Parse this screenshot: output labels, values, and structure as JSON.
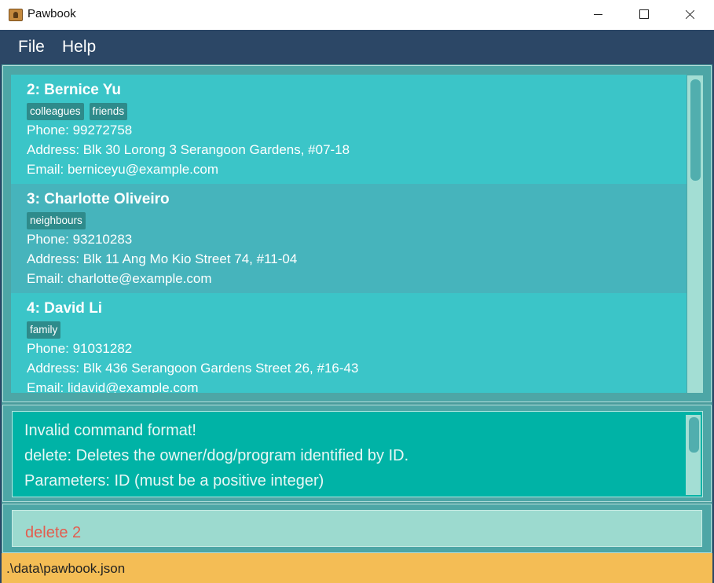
{
  "window": {
    "title": "Pawbook"
  },
  "menu": {
    "file": "File",
    "help": "Help"
  },
  "list": {
    "items": [
      {
        "name": "2:  Bernice Yu",
        "tags": [
          "colleagues",
          "friends"
        ],
        "phone": "Phone: 99272758",
        "address": "Address: Blk 30 Lorong 3 Serangoon Gardens, #07-18",
        "email": "Email: berniceyu@example.com"
      },
      {
        "name": "3:  Charlotte Oliveiro",
        "tags": [
          "neighbours"
        ],
        "phone": "Phone: 93210283",
        "address": "Address: Blk 11 Ang Mo Kio Street 74, #11-04",
        "email": "Email: charlotte@example.com"
      },
      {
        "name": "4:  David Li",
        "tags": [
          "family"
        ],
        "phone": "Phone: 91031282",
        "address": "Address: Blk 436 Serangoon Gardens Street 26, #16-43",
        "email": "Email: lidavid@example.com"
      }
    ]
  },
  "result": {
    "line1": "Invalid command format!",
    "line2": "delete: Deletes the owner/dog/program identified by ID.",
    "line3": "Parameters: ID (must be a positive integer)"
  },
  "command": {
    "value": "delete 2"
  },
  "status": {
    "path": ".\\data\\pawbook.json"
  },
  "colors": {
    "menubar": "#2c4766",
    "card_even": "#3bc5c8",
    "card_odd": "#46b4bc",
    "tag": "#2e8b8b",
    "result_bg": "#00b3a6",
    "command_bg": "#9cdacf",
    "command_text": "#e35d4f",
    "statusbar": "#f4bd55"
  },
  "icons": {
    "app": "paw-book-icon",
    "minimize": "minimize-icon",
    "maximize": "maximize-icon",
    "close": "close-icon"
  }
}
